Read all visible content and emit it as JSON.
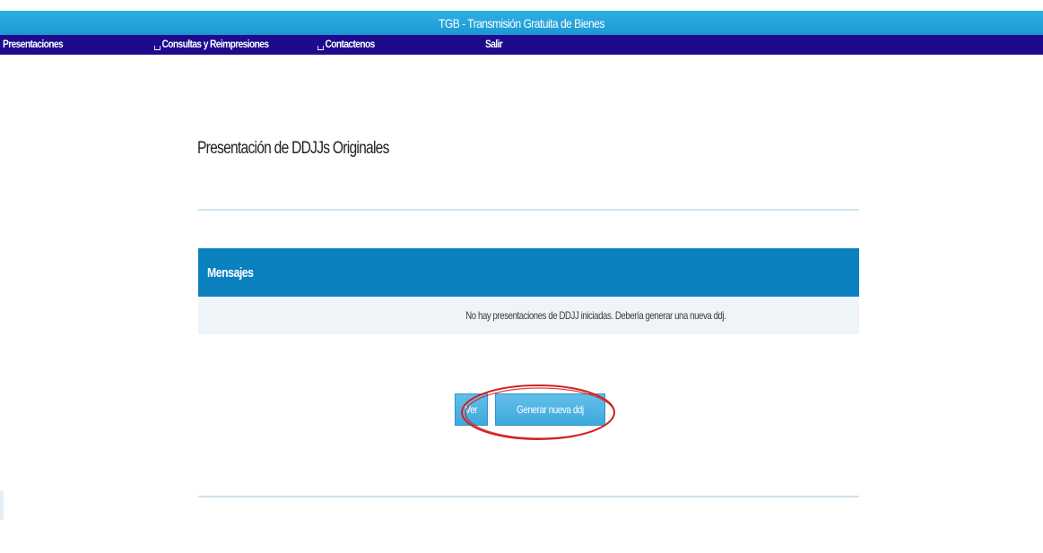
{
  "header": {
    "title": "TGB - Transmisión Gratuita de Bienes"
  },
  "nav": {
    "items": [
      {
        "label": "Presentaciones"
      },
      {
        "label": "Consultas y Reimpresiones"
      },
      {
        "label": "Contactenos"
      },
      {
        "label": "Salir"
      }
    ]
  },
  "main": {
    "title": "Presentación de DDJJs Originales",
    "messages": {
      "header": "Mensajes",
      "text": "No hay presentaciones de DDJJ iniciadas. Debería generar una nueva ddj."
    },
    "buttons": {
      "ver_label": "Ver",
      "generar_label": "Generar nueva ddj"
    }
  },
  "colors": {
    "top_bar": "#1b98d3",
    "nav_bar": "#1f0a8c",
    "messages_header": "#0a80bf",
    "button": "#3ea9dd",
    "highlight": "#d42020"
  }
}
